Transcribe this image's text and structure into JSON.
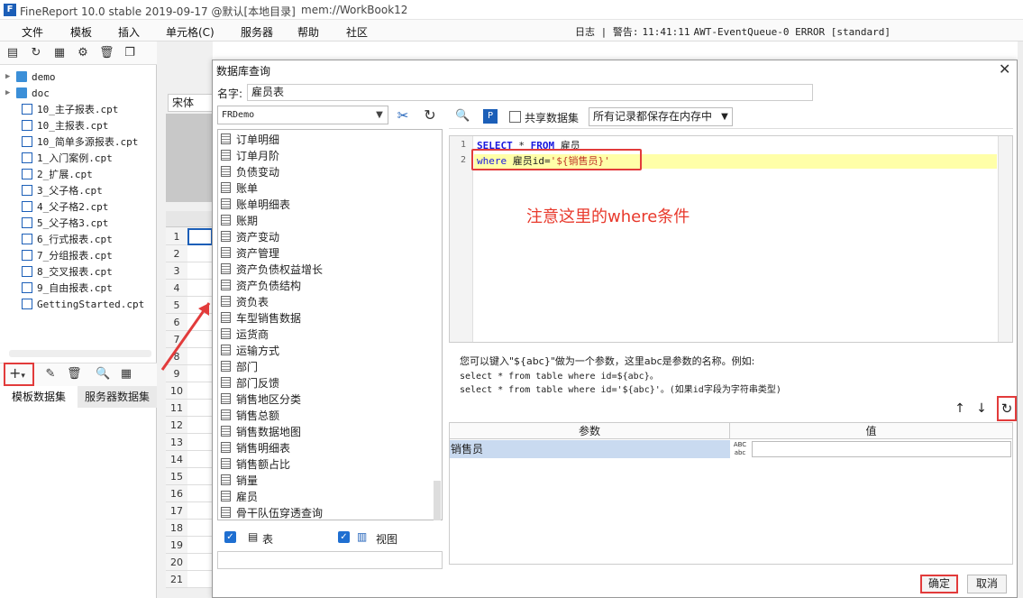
{
  "app": {
    "title": "FineReport 10.0 stable 2019-09-17 @默认[本地目录]",
    "document": "mem://WorkBook12"
  },
  "menu": [
    "文件",
    "模板",
    "插入",
    "单元格(C)",
    "服务器",
    "帮助",
    "社区"
  ],
  "status": {
    "log_label": "日志",
    "warn_label": "警告:",
    "timestamp": "11:41:11",
    "message": "AWT-EventQueue-0 ERROR [standard]"
  },
  "file_tree": [
    {
      "name": "demo",
      "type": "folder"
    },
    {
      "name": "doc",
      "type": "folder"
    },
    {
      "name": "10_主子报表.cpt",
      "type": "file"
    },
    {
      "name": "10_主报表.cpt",
      "type": "file"
    },
    {
      "name": "10_简单多源报表.cpt",
      "type": "file"
    },
    {
      "name": "1_入门案例.cpt",
      "type": "file"
    },
    {
      "name": "2_扩展.cpt",
      "type": "file"
    },
    {
      "name": "3_父子格.cpt",
      "type": "file"
    },
    {
      "name": "4_父子格2.cpt",
      "type": "file"
    },
    {
      "name": "5_父子格3.cpt",
      "type": "file"
    },
    {
      "name": "6_行式报表.cpt",
      "type": "file"
    },
    {
      "name": "7_分组报表.cpt",
      "type": "file"
    },
    {
      "name": "8_交叉报表.cpt",
      "type": "file"
    },
    {
      "name": "9_自由报表.cpt",
      "type": "file"
    },
    {
      "name": "GettingStarted.cpt",
      "type": "file"
    }
  ],
  "dataset_tabs": [
    "模板数据集",
    "服务器数据集"
  ],
  "sheet": {
    "font": "宋体",
    "rows": [
      "1",
      "2",
      "3",
      "4",
      "5",
      "6",
      "7",
      "8",
      "9",
      "10",
      "11",
      "12",
      "13",
      "14",
      "15",
      "16",
      "17",
      "18",
      "19",
      "20",
      "21"
    ]
  },
  "dialog": {
    "title": "数据库查询",
    "name_label": "名字:",
    "name_value": "雇员表",
    "connection": "FRDemo",
    "tables": [
      "订单明细",
      "订单月阶",
      "负债变动",
      "账单",
      "账单明细表",
      "账期",
      "资产变动",
      "资产管理",
      "资产负债权益增长",
      "资产负债结构",
      "资负表",
      "车型销售数据",
      "运货商",
      "运输方式",
      "部门",
      "部门反馈",
      "销售地区分类",
      "销售总额",
      "销售数据地图",
      "销售明细表",
      "销售额占比",
      "销量",
      "雇员",
      "骨干队伍穿透查询"
    ],
    "filter_table_label": "表",
    "filter_view_label": "视图",
    "share_label": "共享数据集",
    "cache_option": "所有记录都保存在内存中",
    "sql": {
      "line1_kw1": "SELECT",
      "line1_star": " * ",
      "line1_kw2": "FROM",
      "line1_table": " 雇员",
      "line2_kw": "where",
      "line2_field": " 雇员id=",
      "line2_str": "'${销售员}'"
    },
    "annotation": "注意这里的where条件",
    "help_lines": [
      "您可以键入\"${abc}\"做为一个参数，这里abc是参数的名称。例如:",
      "select * from table where id=${abc}。",
      "select * from table where id='${abc}'。(如果id字段为字符串类型)"
    ],
    "param_headers": {
      "param": "参数",
      "value": "值"
    },
    "params": [
      {
        "name": "销售员",
        "value": ""
      }
    ],
    "ok_label": "确定",
    "cancel_label": "取消"
  },
  "colors": {
    "accent": "#1c5fb8",
    "highlight_red": "#e23b3b",
    "selected_row": "#c9daf0"
  }
}
